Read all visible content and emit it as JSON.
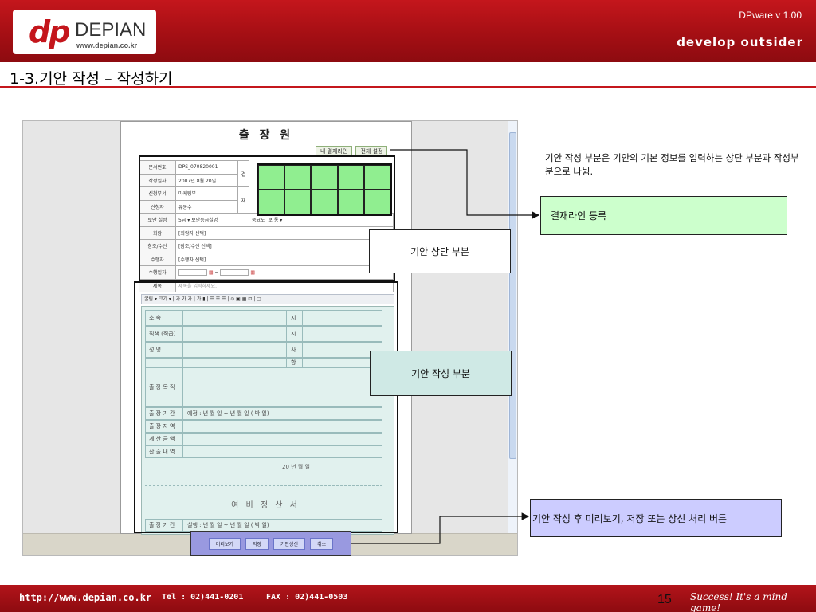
{
  "header": {
    "logo_mark": "dp",
    "logo_word": "DEPIAN",
    "logo_url": "www.depian.co.kr",
    "version": "DPware v 1.00",
    "tagline": "develop outsider"
  },
  "slide_title": "1-3.기안 작성 – 작성하기",
  "screenshot": {
    "doc_title": "출 장 원",
    "top_buttons": [
      "내 결재라인",
      "전체 설정"
    ],
    "info_rows": [
      {
        "label": "문서번호",
        "value": "DPS_070820001"
      },
      {
        "label": "작성일자",
        "value": "2007년 8월 20일"
      },
      {
        "label": "신청부서",
        "value": "마케팅부"
      },
      {
        "label": "신청자",
        "value": "유동수"
      },
      {
        "label": "보안 설정",
        "value": "5급 ▾ 보안등급설명",
        "extra_label": "중요도",
        "extra_value": "보 통 ▾"
      },
      {
        "label": "회람",
        "value": "[회람자 선택]"
      },
      {
        "label": "참조/수신",
        "value": "[참조/수신 선택]"
      },
      {
        "label": "수행자",
        "value": "[수행자 선택]"
      },
      {
        "label": "수행일자",
        "value": "~"
      },
      {
        "label": "제목",
        "value": "제목을 입력하세요."
      }
    ],
    "approval_side": [
      "결",
      "재"
    ],
    "editor_toolbar": "굴림 ▾ 크기 ▾ | 가 가 가 | 가 ▮ | ☰ ☰ ☰ | ⊙ ▣ ▦ ⊡ | ▢",
    "form_rows": [
      {
        "label": "소      속",
        "right_label": "지"
      },
      {
        "label": "직책 (직급)",
        "right_label": "시"
      },
      {
        "label": "성      명",
        "right_label": "사"
      },
      {
        "label": "",
        "right_label": "항"
      },
      {
        "label": "출 장 목 적"
      },
      {
        "label": "출 장 기 간",
        "value": "예정 :       년    월    일  ~       년    월    일  (   박    일)"
      },
      {
        "label": "출 장 지 역"
      },
      {
        "label": "계 산 금 액"
      },
      {
        "label": "산 출 내 역"
      }
    ],
    "date_line": "20     년      월      일",
    "yebi_title": "여 비 정 산 서",
    "settle_row": {
      "label": "출 장 기 간",
      "value": "실행 :       년    월    일  ~       년    월    일  (   박    일)"
    },
    "action_buttons": [
      "미리보기",
      "저장",
      "기안상신",
      "취소"
    ]
  },
  "description": "기안 작성 부분은 기안의 기본 정보를 입력하는 상단 부분과 작성부분으로 나뉨.",
  "callouts": {
    "approval_line": "결재라인 등록",
    "top_part": "기안 상단 부분",
    "write_part": "기안 작성 부분",
    "action_note": "기안 작성 후 미리보기, 저장 또는 상신 처리 버튼"
  },
  "footer": {
    "url": "http://www.depian.co.kr",
    "tel": "Tel : 02)441-0201",
    "fax": "FAX : 02)441-0503",
    "page": "15",
    "slogan": "Success! It's a mind game!"
  },
  "colors": {
    "brand_red": "#c4161c",
    "approval_green": "#90ee90",
    "callout_green": "#ccffcc",
    "callout_teal": "#cfe9e5",
    "callout_blue": "#ccccff",
    "action_bar": "#9999e0"
  }
}
